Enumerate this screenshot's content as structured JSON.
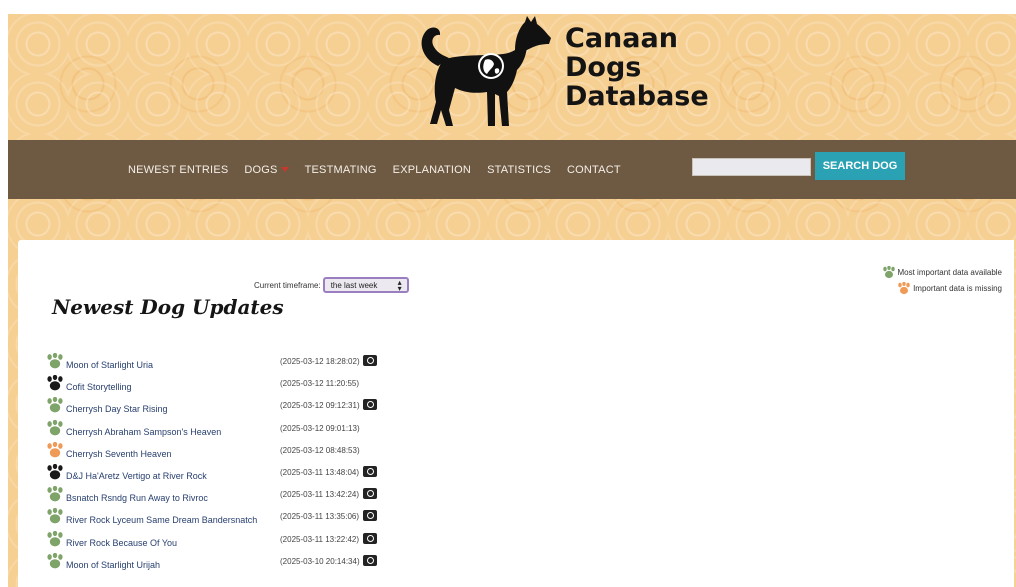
{
  "site": {
    "title_lines": [
      "Canaan",
      "Dogs",
      "Database"
    ]
  },
  "nav": {
    "items": [
      {
        "label": "NEWEST ENTRIES"
      },
      {
        "label": "DOGS"
      },
      {
        "label": "TESTMATING"
      },
      {
        "label": "EXPLANATION"
      },
      {
        "label": "STATISTICS"
      },
      {
        "label": "CONTACT"
      }
    ],
    "search_placeholder": "",
    "search_button": "SEARCH DOG"
  },
  "page": {
    "title": "Newest Dog Updates",
    "timeframe_label": "Current timeframe:",
    "timeframe_value": "the last week"
  },
  "legend": {
    "items": [
      {
        "label": "Most important data available",
        "color": "#7fa46a"
      },
      {
        "label": "Important data is missing",
        "color": "#ef9a57"
      }
    ]
  },
  "colors": {
    "paw_green": "#7fa46a",
    "paw_black": "#1a1a1a",
    "paw_orange": "#ef9a57",
    "accent": "#2aa2b3",
    "nav_bg": "#6e5a43"
  },
  "entries": [
    {
      "name": "Moon of Starlight Uria",
      "timestamp": "(2025-03-12 18:28:02)",
      "paw": "paw_green",
      "has_photo": true
    },
    {
      "name": "Cofit Storytelling",
      "timestamp": "(2025-03-12 11:20:55)",
      "paw": "paw_black",
      "has_photo": false
    },
    {
      "name": "Cherrysh Day Star Rising",
      "timestamp": "(2025-03-12 09:12:31)",
      "paw": "paw_green",
      "has_photo": true
    },
    {
      "name": "Cherrysh Abraham Sampson's Heaven",
      "timestamp": "(2025-03-12 09:01:13)",
      "paw": "paw_green",
      "has_photo": false
    },
    {
      "name": "Cherrysh Seventh Heaven",
      "timestamp": "(2025-03-12 08:48:53)",
      "paw": "paw_orange",
      "has_photo": false
    },
    {
      "name": "D&J Ha'Aretz Vertigo at River Rock",
      "timestamp": "(2025-03-11 13:48:04)",
      "paw": "paw_black",
      "has_photo": true
    },
    {
      "name": "Bsnatch Rsndg Run Away to Rivroc",
      "timestamp": "(2025-03-11 13:42:24)",
      "paw": "paw_green",
      "has_photo": true
    },
    {
      "name": "River Rock Lyceum Same Dream Bandersnatch",
      "timestamp": "(2025-03-11 13:35:06)",
      "paw": "paw_green",
      "has_photo": true
    },
    {
      "name": "River Rock Because Of You",
      "timestamp": "(2025-03-11 13:22:42)",
      "paw": "paw_green",
      "has_photo": true
    },
    {
      "name": "Moon of Starlight Urijah",
      "timestamp": "(2025-03-10 20:14:34)",
      "paw": "paw_green",
      "has_photo": true
    }
  ]
}
